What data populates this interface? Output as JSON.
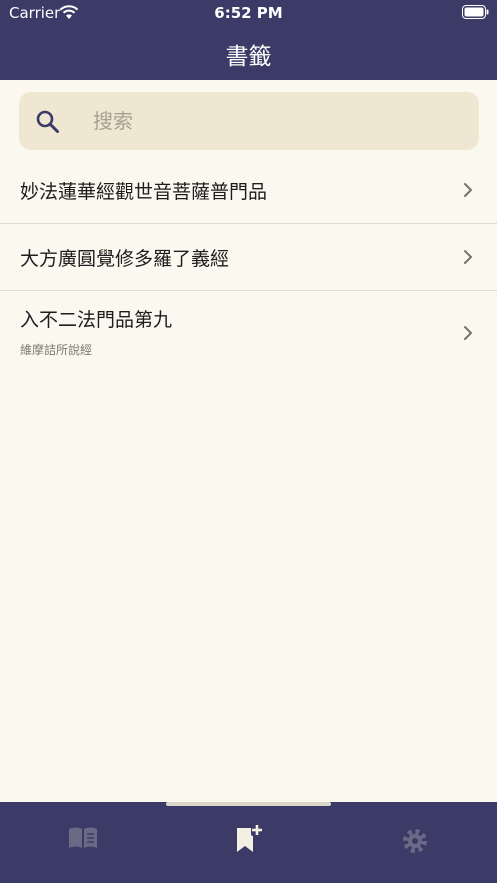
{
  "status_bar": {
    "carrier": "Carrier",
    "time": "6:52 PM"
  },
  "nav": {
    "title": "書籤"
  },
  "search": {
    "placeholder": "搜索",
    "value": ""
  },
  "bookmarks": [
    {
      "title": "妙法蓮華經觀世音菩薩普門品",
      "subtitle": ""
    },
    {
      "title": "大方廣圓覺修多羅了義經",
      "subtitle": ""
    },
    {
      "title": "入不二法門品第九",
      "subtitle": "維摩詰所說經"
    }
  ],
  "tabs": [
    {
      "icon": "book-icon",
      "selected": false
    },
    {
      "icon": "bookmark-add-icon",
      "selected": true
    },
    {
      "icon": "gear-icon",
      "selected": false
    }
  ],
  "colors": {
    "bar": "#3c3a66",
    "background": "#fbf8f0",
    "search_field": "#efe7d1",
    "selected_tab": "#f3efe2",
    "unselected_tab": "#6b6a86"
  }
}
